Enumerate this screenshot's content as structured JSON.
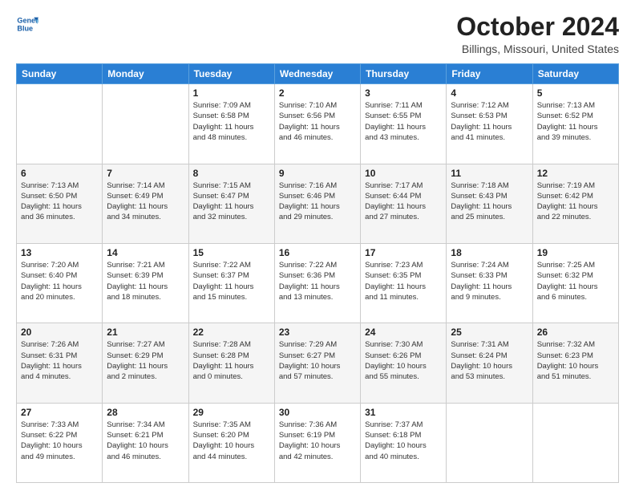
{
  "header": {
    "logo_line1": "General",
    "logo_line2": "Blue",
    "title": "October 2024",
    "subtitle": "Billings, Missouri, United States"
  },
  "days_of_week": [
    "Sunday",
    "Monday",
    "Tuesday",
    "Wednesday",
    "Thursday",
    "Friday",
    "Saturday"
  ],
  "weeks": [
    [
      {
        "day": "",
        "info": ""
      },
      {
        "day": "",
        "info": ""
      },
      {
        "day": "1",
        "info": "Sunrise: 7:09 AM\nSunset: 6:58 PM\nDaylight: 11 hours\nand 48 minutes."
      },
      {
        "day": "2",
        "info": "Sunrise: 7:10 AM\nSunset: 6:56 PM\nDaylight: 11 hours\nand 46 minutes."
      },
      {
        "day": "3",
        "info": "Sunrise: 7:11 AM\nSunset: 6:55 PM\nDaylight: 11 hours\nand 43 minutes."
      },
      {
        "day": "4",
        "info": "Sunrise: 7:12 AM\nSunset: 6:53 PM\nDaylight: 11 hours\nand 41 minutes."
      },
      {
        "day": "5",
        "info": "Sunrise: 7:13 AM\nSunset: 6:52 PM\nDaylight: 11 hours\nand 39 minutes."
      }
    ],
    [
      {
        "day": "6",
        "info": "Sunrise: 7:13 AM\nSunset: 6:50 PM\nDaylight: 11 hours\nand 36 minutes."
      },
      {
        "day": "7",
        "info": "Sunrise: 7:14 AM\nSunset: 6:49 PM\nDaylight: 11 hours\nand 34 minutes."
      },
      {
        "day": "8",
        "info": "Sunrise: 7:15 AM\nSunset: 6:47 PM\nDaylight: 11 hours\nand 32 minutes."
      },
      {
        "day": "9",
        "info": "Sunrise: 7:16 AM\nSunset: 6:46 PM\nDaylight: 11 hours\nand 29 minutes."
      },
      {
        "day": "10",
        "info": "Sunrise: 7:17 AM\nSunset: 6:44 PM\nDaylight: 11 hours\nand 27 minutes."
      },
      {
        "day": "11",
        "info": "Sunrise: 7:18 AM\nSunset: 6:43 PM\nDaylight: 11 hours\nand 25 minutes."
      },
      {
        "day": "12",
        "info": "Sunrise: 7:19 AM\nSunset: 6:42 PM\nDaylight: 11 hours\nand 22 minutes."
      }
    ],
    [
      {
        "day": "13",
        "info": "Sunrise: 7:20 AM\nSunset: 6:40 PM\nDaylight: 11 hours\nand 20 minutes."
      },
      {
        "day": "14",
        "info": "Sunrise: 7:21 AM\nSunset: 6:39 PM\nDaylight: 11 hours\nand 18 minutes."
      },
      {
        "day": "15",
        "info": "Sunrise: 7:22 AM\nSunset: 6:37 PM\nDaylight: 11 hours\nand 15 minutes."
      },
      {
        "day": "16",
        "info": "Sunrise: 7:22 AM\nSunset: 6:36 PM\nDaylight: 11 hours\nand 13 minutes."
      },
      {
        "day": "17",
        "info": "Sunrise: 7:23 AM\nSunset: 6:35 PM\nDaylight: 11 hours\nand 11 minutes."
      },
      {
        "day": "18",
        "info": "Sunrise: 7:24 AM\nSunset: 6:33 PM\nDaylight: 11 hours\nand 9 minutes."
      },
      {
        "day": "19",
        "info": "Sunrise: 7:25 AM\nSunset: 6:32 PM\nDaylight: 11 hours\nand 6 minutes."
      }
    ],
    [
      {
        "day": "20",
        "info": "Sunrise: 7:26 AM\nSunset: 6:31 PM\nDaylight: 11 hours\nand 4 minutes."
      },
      {
        "day": "21",
        "info": "Sunrise: 7:27 AM\nSunset: 6:29 PM\nDaylight: 11 hours\nand 2 minutes."
      },
      {
        "day": "22",
        "info": "Sunrise: 7:28 AM\nSunset: 6:28 PM\nDaylight: 11 hours\nand 0 minutes."
      },
      {
        "day": "23",
        "info": "Sunrise: 7:29 AM\nSunset: 6:27 PM\nDaylight: 10 hours\nand 57 minutes."
      },
      {
        "day": "24",
        "info": "Sunrise: 7:30 AM\nSunset: 6:26 PM\nDaylight: 10 hours\nand 55 minutes."
      },
      {
        "day": "25",
        "info": "Sunrise: 7:31 AM\nSunset: 6:24 PM\nDaylight: 10 hours\nand 53 minutes."
      },
      {
        "day": "26",
        "info": "Sunrise: 7:32 AM\nSunset: 6:23 PM\nDaylight: 10 hours\nand 51 minutes."
      }
    ],
    [
      {
        "day": "27",
        "info": "Sunrise: 7:33 AM\nSunset: 6:22 PM\nDaylight: 10 hours\nand 49 minutes."
      },
      {
        "day": "28",
        "info": "Sunrise: 7:34 AM\nSunset: 6:21 PM\nDaylight: 10 hours\nand 46 minutes."
      },
      {
        "day": "29",
        "info": "Sunrise: 7:35 AM\nSunset: 6:20 PM\nDaylight: 10 hours\nand 44 minutes."
      },
      {
        "day": "30",
        "info": "Sunrise: 7:36 AM\nSunset: 6:19 PM\nDaylight: 10 hours\nand 42 minutes."
      },
      {
        "day": "31",
        "info": "Sunrise: 7:37 AM\nSunset: 6:18 PM\nDaylight: 10 hours\nand 40 minutes."
      },
      {
        "day": "",
        "info": ""
      },
      {
        "day": "",
        "info": ""
      }
    ]
  ]
}
